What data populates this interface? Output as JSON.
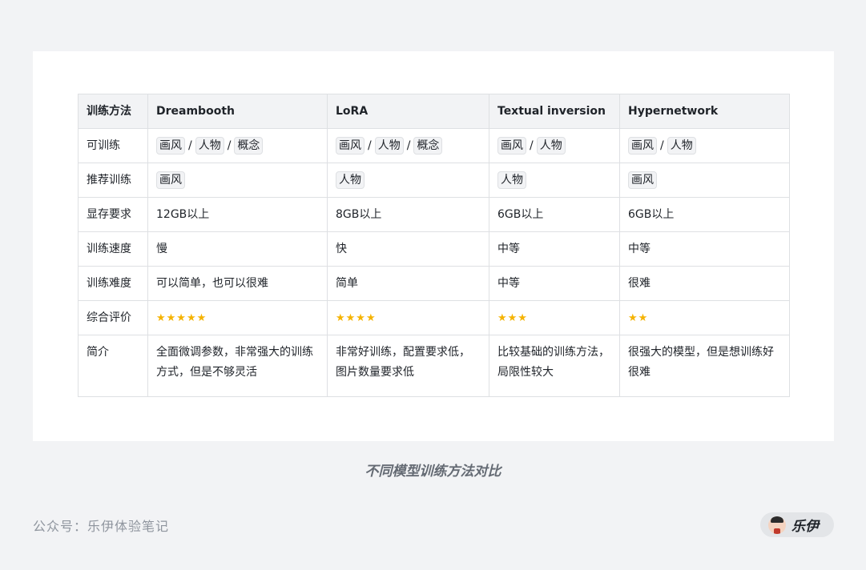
{
  "table": {
    "headers": [
      "训练方法",
      "Dreambooth",
      "LoRA",
      "Textual inversion",
      "Hypernetwork"
    ],
    "rows": {
      "trainable": {
        "label": "可训练",
        "dreambooth": [
          "画风",
          "人物",
          "概念"
        ],
        "lora": [
          "画风",
          "人物",
          "概念"
        ],
        "textual": [
          "画风",
          "人物"
        ],
        "hyper": [
          "画风",
          "人物"
        ]
      },
      "recommended": {
        "label": "推荐训练",
        "dreambooth": "画风",
        "lora": "人物",
        "textual": "人物",
        "hyper": "画风"
      },
      "vram": {
        "label": "显存要求",
        "dreambooth": "12GB以上",
        "lora": "8GB以上",
        "textual": "6GB以上",
        "hyper": "6GB以上"
      },
      "speed": {
        "label": "训练速度",
        "dreambooth": "慢",
        "lora": "快",
        "textual": "中等",
        "hyper": "中等"
      },
      "difficulty": {
        "label": "训练难度",
        "dreambooth": "可以简单，也可以很难",
        "lora": "简单",
        "textual": "中等",
        "hyper": "很难"
      },
      "rating": {
        "label": "综合评价",
        "dreambooth": 5,
        "lora": 4,
        "textual": 3,
        "hyper": 2
      },
      "summary": {
        "label": "简介",
        "dreambooth": "全面微调参数，非常强大的训练方式，但是不够灵活",
        "lora": "非常好训练，配置要求低，图片数量要求低",
        "textual": "比较基础的训练方法，局限性较大",
        "hyper": "很强大的模型，但是想训练好很难"
      }
    },
    "separator": "/"
  },
  "caption": "不同模型训练方法对比",
  "footer": {
    "account": "公众号：乐伊体验笔记",
    "author_name": "乐伊"
  },
  "colors": {
    "star": "#f5b300",
    "header_bg": "#f2f3f5",
    "border": "#dee0e3"
  }
}
